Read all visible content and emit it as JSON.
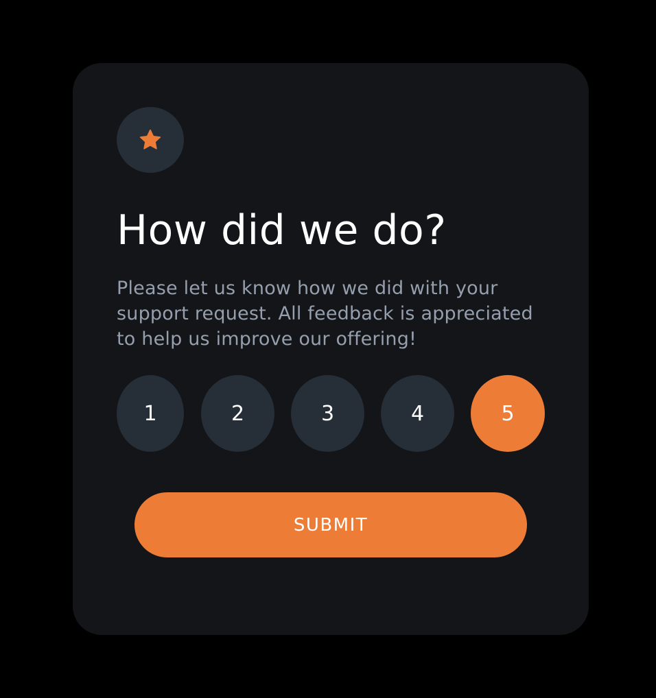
{
  "card": {
    "icon": "star-icon",
    "title": "How did we do?",
    "description": "Please let us know how we did with your support request. All feedback is appreciated to help us improve our offering!"
  },
  "ratings": {
    "options": [
      "1",
      "2",
      "3",
      "4",
      "5"
    ],
    "selected": "5"
  },
  "submit": {
    "label": "SUBMIT"
  },
  "colors": {
    "accent": "#ec7c36",
    "card_bg": "#131518",
    "circle_bg": "#262e38",
    "text_muted": "#969fad",
    "page_bg": "#000000"
  }
}
